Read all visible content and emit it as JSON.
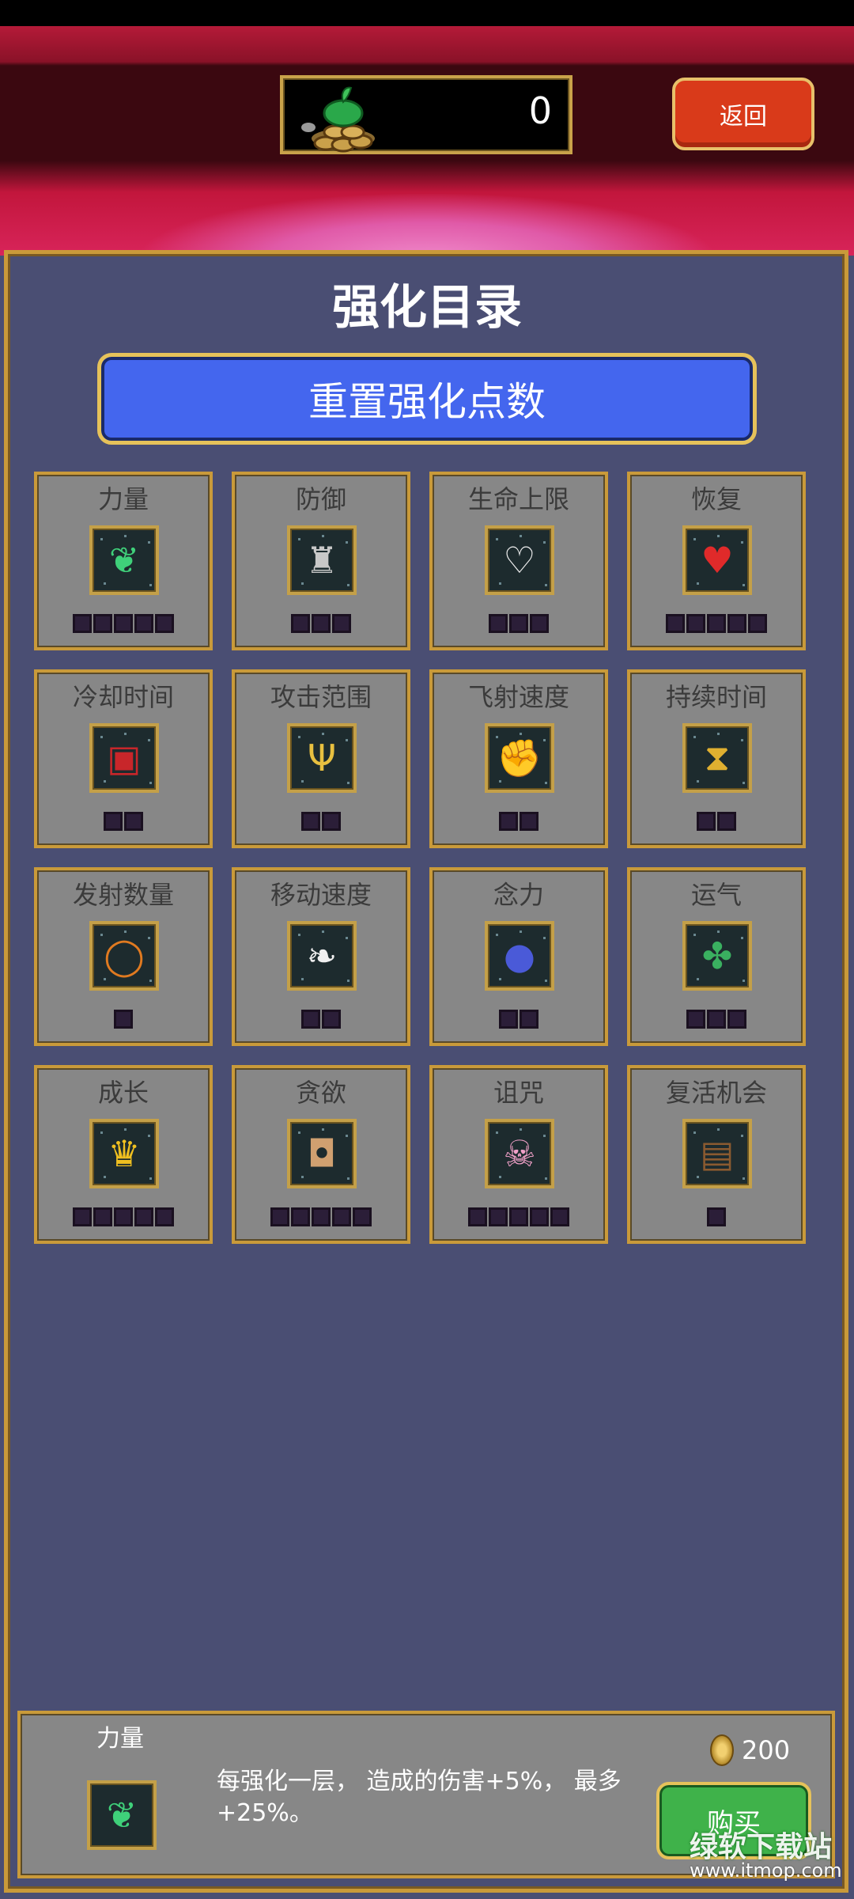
{
  "header": {
    "coin_value": "0",
    "back_label": "返回"
  },
  "panel": {
    "title": "强化目录",
    "reset_label": "重置强化点数"
  },
  "upgrades": [
    {
      "label": "力量",
      "icon": "feather-icon",
      "pips": 5
    },
    {
      "label": "防御",
      "icon": "armor-icon",
      "pips": 3
    },
    {
      "label": "生命上限",
      "icon": "heart-outline-icon",
      "pips": 3
    },
    {
      "label": "恢复",
      "icon": "heart-icon",
      "pips": 5
    },
    {
      "label": "冷却时间",
      "icon": "book-icon",
      "pips": 2
    },
    {
      "label": "攻击范围",
      "icon": "candelabra-icon",
      "pips": 2
    },
    {
      "label": "飞射速度",
      "icon": "gauntlet-icon",
      "pips": 2
    },
    {
      "label": "持续时间",
      "icon": "hourglass-icon",
      "pips": 2
    },
    {
      "label": "发射数量",
      "icon": "ring-icon",
      "pips": 1
    },
    {
      "label": "移动速度",
      "icon": "wing-icon",
      "pips": 2
    },
    {
      "label": "念力",
      "icon": "orb-icon",
      "pips": 2
    },
    {
      "label": "运气",
      "icon": "clover-icon",
      "pips": 3
    },
    {
      "label": "成长",
      "icon": "crown-icon",
      "pips": 5
    },
    {
      "label": "贪欲",
      "icon": "mask-icon",
      "pips": 5
    },
    {
      "label": "诅咒",
      "icon": "skull-icon",
      "pips": 5
    },
    {
      "label": "复活机会",
      "icon": "cake-icon",
      "pips": 1
    }
  ],
  "selected": {
    "name": "力量",
    "icon": "feather-icon",
    "description": "每强化一层， 造成的伤害+5%， 最多+25%。",
    "price": "200",
    "buy_label": "购买"
  },
  "watermark": {
    "text": "绿软下载站",
    "url": "www.itmop.com"
  }
}
